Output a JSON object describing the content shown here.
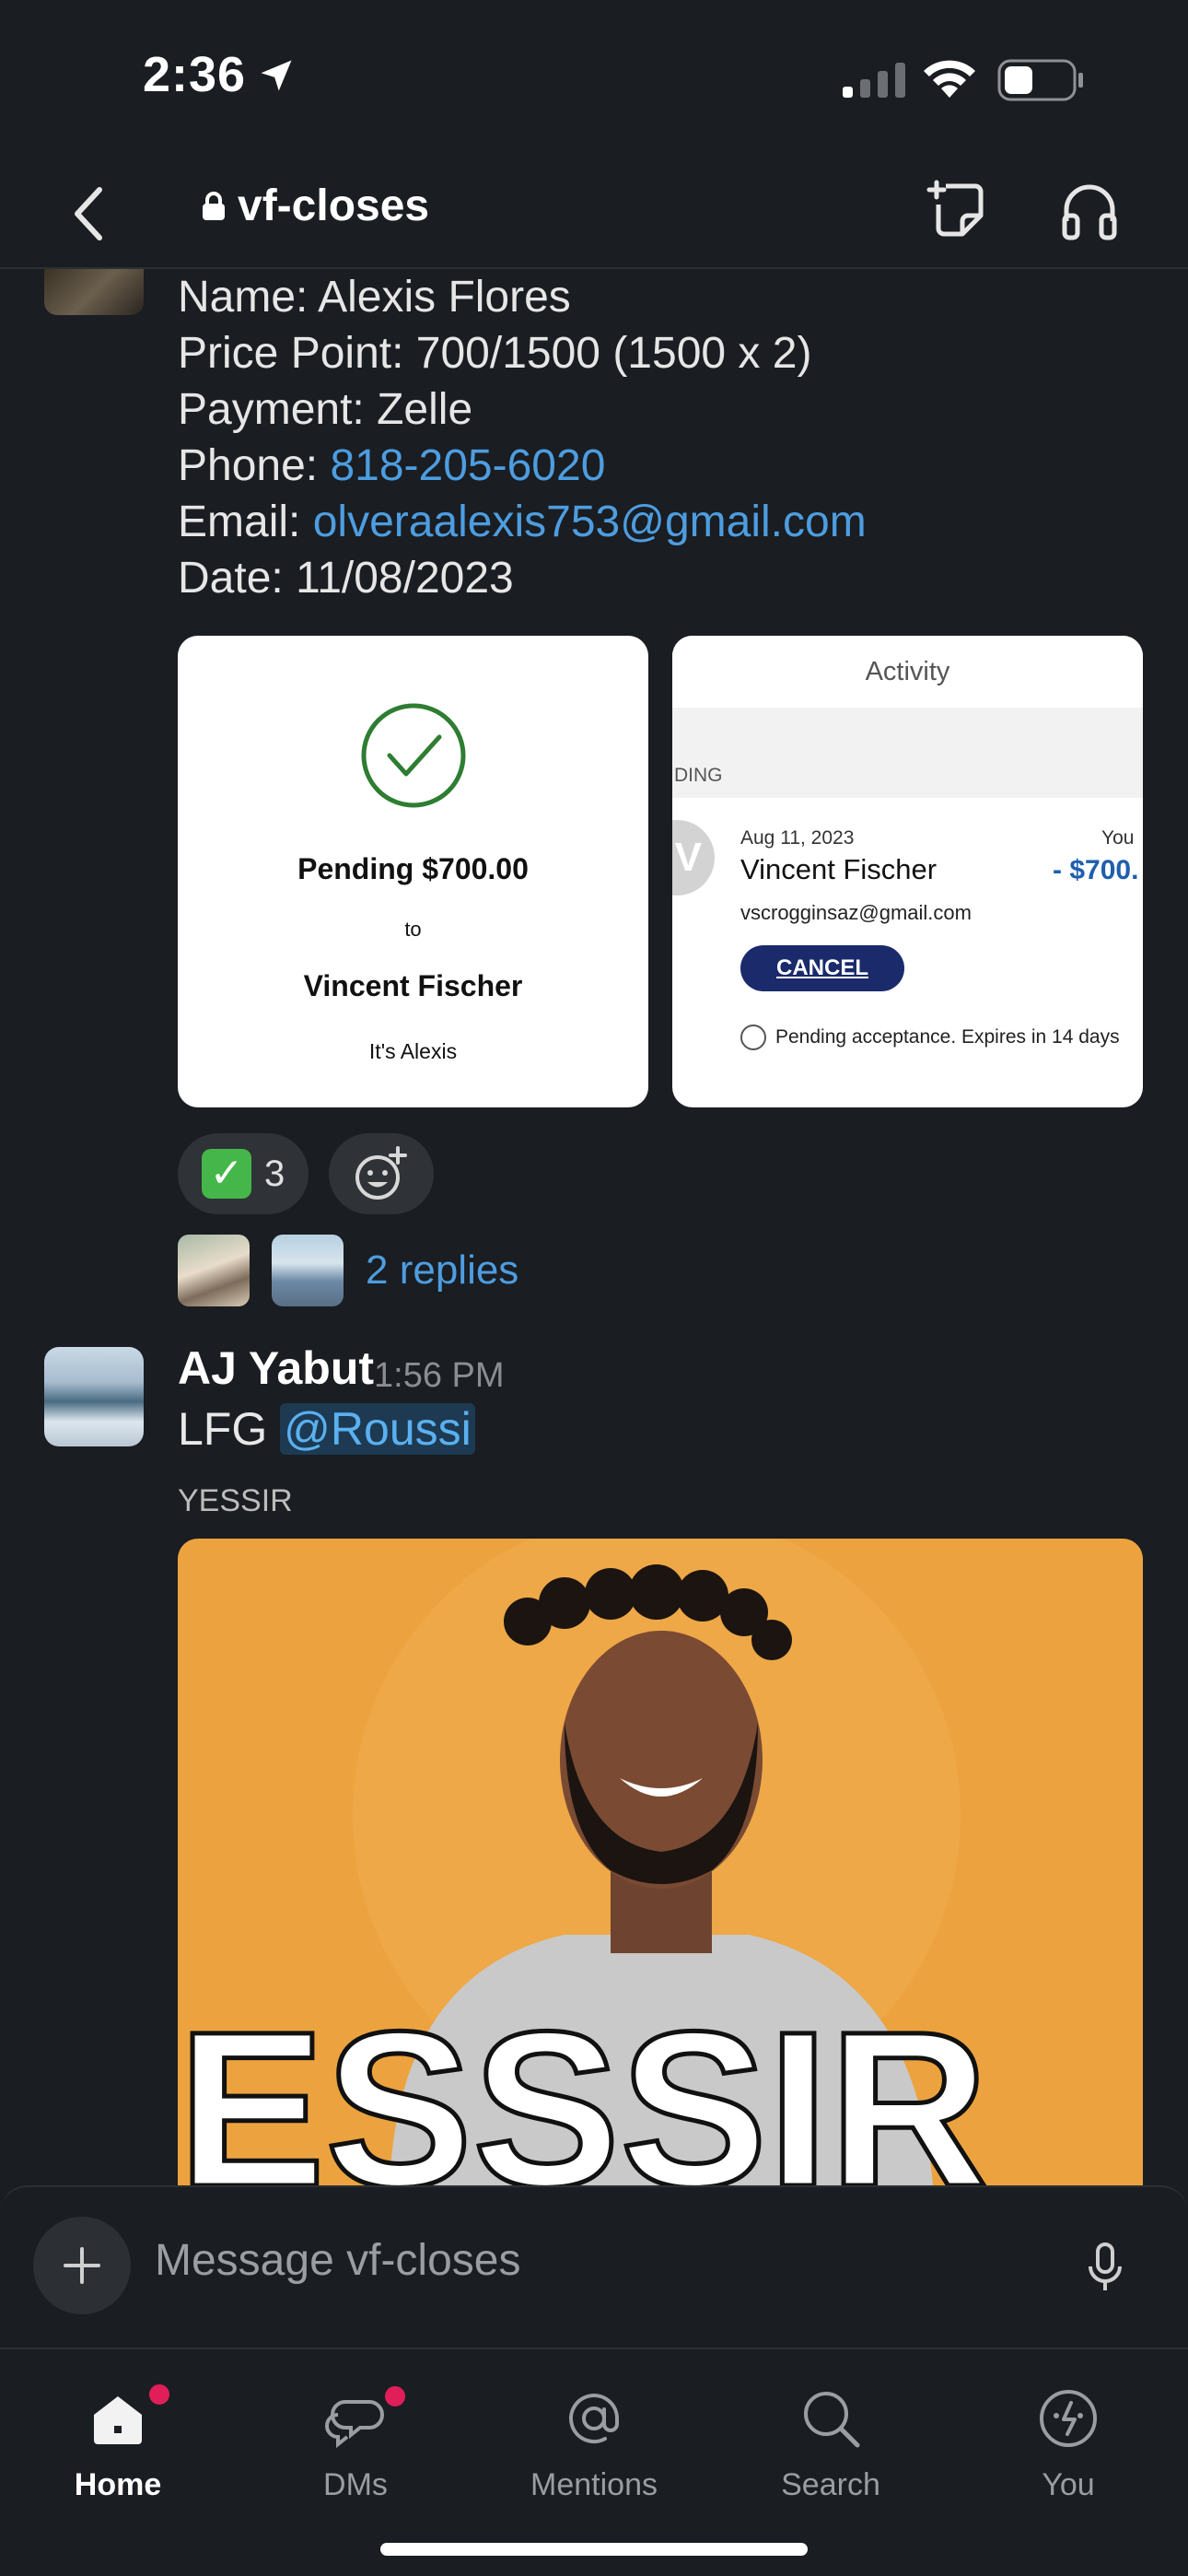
{
  "status": {
    "time": "2:36"
  },
  "header": {
    "channel": "vf-closes"
  },
  "message1": {
    "name_line": "Name: Alexis Flores",
    "price_line": "Price Point: 700/1500 (1500 x 2)",
    "payment_line": "Payment: Zelle",
    "phone_label": "Phone: ",
    "phone": "818-205-6020",
    "email_label": "Email: ",
    "email": "olveraalexis753@gmail.com",
    "date_line": "Date: 11/08/2023",
    "card1": {
      "amount": "Pending $700.00",
      "to": "to",
      "name": "Vincent Fischer",
      "note": "It's Alexis"
    },
    "card2": {
      "header": "Activity",
      "pending": "DING",
      "avatar_letter": "V",
      "date": "Aug 11, 2023",
      "you": "You",
      "name": "Vincent Fischer",
      "amount": "- $700.",
      "email": "vscrogginsaz@gmail.com",
      "cancel": "CANCEL",
      "expire": "Pending acceptance. Expires in 14 days"
    },
    "reaction": {
      "emoji": "✓",
      "count": "3"
    },
    "replies": "2 replies"
  },
  "message2": {
    "author": "AJ Yabut",
    "time": "1:56 PM",
    "text": "LFG ",
    "mention": "@Roussi",
    "gif_title": "YESSIR",
    "gif_caption": "ESSSIR"
  },
  "composer": {
    "placeholder": "Message vf-closes"
  },
  "tabs": [
    {
      "label": "Home"
    },
    {
      "label": "DMs"
    },
    {
      "label": "Mentions"
    },
    {
      "label": "Search"
    },
    {
      "label": "You"
    }
  ],
  "colors": {
    "link": "#4d9de0",
    "badge": "#e01e5a",
    "background": "#1a1d21",
    "gif_bg": "#eca33f"
  }
}
